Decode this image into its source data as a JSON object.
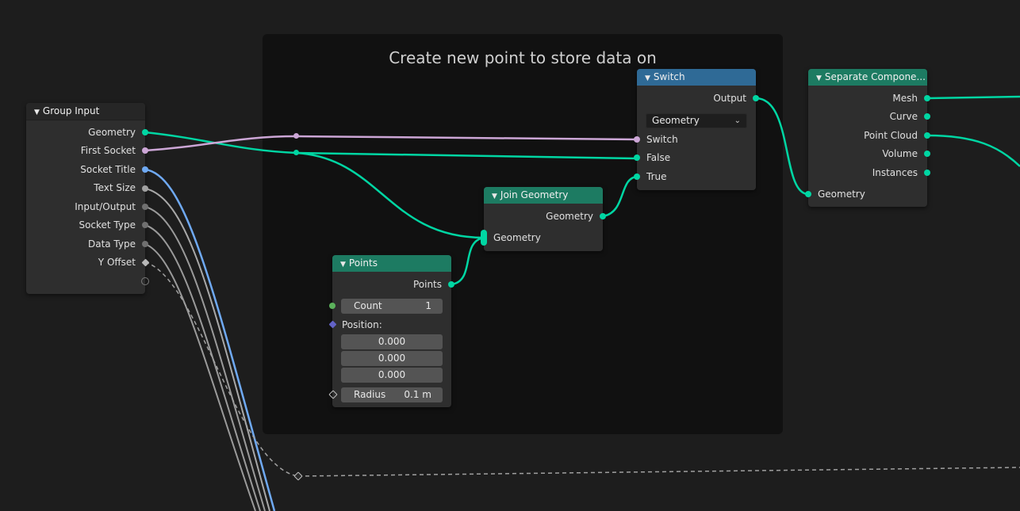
{
  "frame": {
    "label": "Create new point to store data on"
  },
  "group_input": {
    "title": "Group Input",
    "outputs": [
      "Geometry",
      "First Socket",
      "Socket Title",
      "Text Size",
      "Input/Output",
      "Socket Type",
      "Data Type",
      "Y Offset"
    ]
  },
  "switch_node": {
    "title": "Switch",
    "output": "Output",
    "type_value": "Geometry",
    "inputs": [
      "Switch",
      "False",
      "True"
    ]
  },
  "join_geometry": {
    "title": "Join Geometry",
    "output": "Geometry",
    "input": "Geometry"
  },
  "points_node": {
    "title": "Points",
    "output": "Points",
    "count_label": "Count",
    "count_value": "1",
    "position_label": "Position:",
    "position_values": [
      "0.000",
      "0.000",
      "0.000"
    ],
    "radius_label": "Radius",
    "radius_value": "0.1 m"
  },
  "separate_components": {
    "title": "Separate Compone...",
    "outputs": [
      "Mesh",
      "Curve",
      "Point Cloud",
      "Volume",
      "Instances"
    ],
    "input": "Geometry"
  },
  "colors": {
    "background": "#1d1d1d",
    "frame": "#111111",
    "node_body": "#2e2e2e",
    "geometry_socket": "#00d6a3",
    "boolean_socket": "#cca6d6",
    "string_socket": "#6fa9f2",
    "header_geometry": "#1d7b62",
    "header_switch": "#2f6a96"
  },
  "icons": {
    "collapse": "chevron-down-icon",
    "dropdown": "chevron-down-icon"
  }
}
